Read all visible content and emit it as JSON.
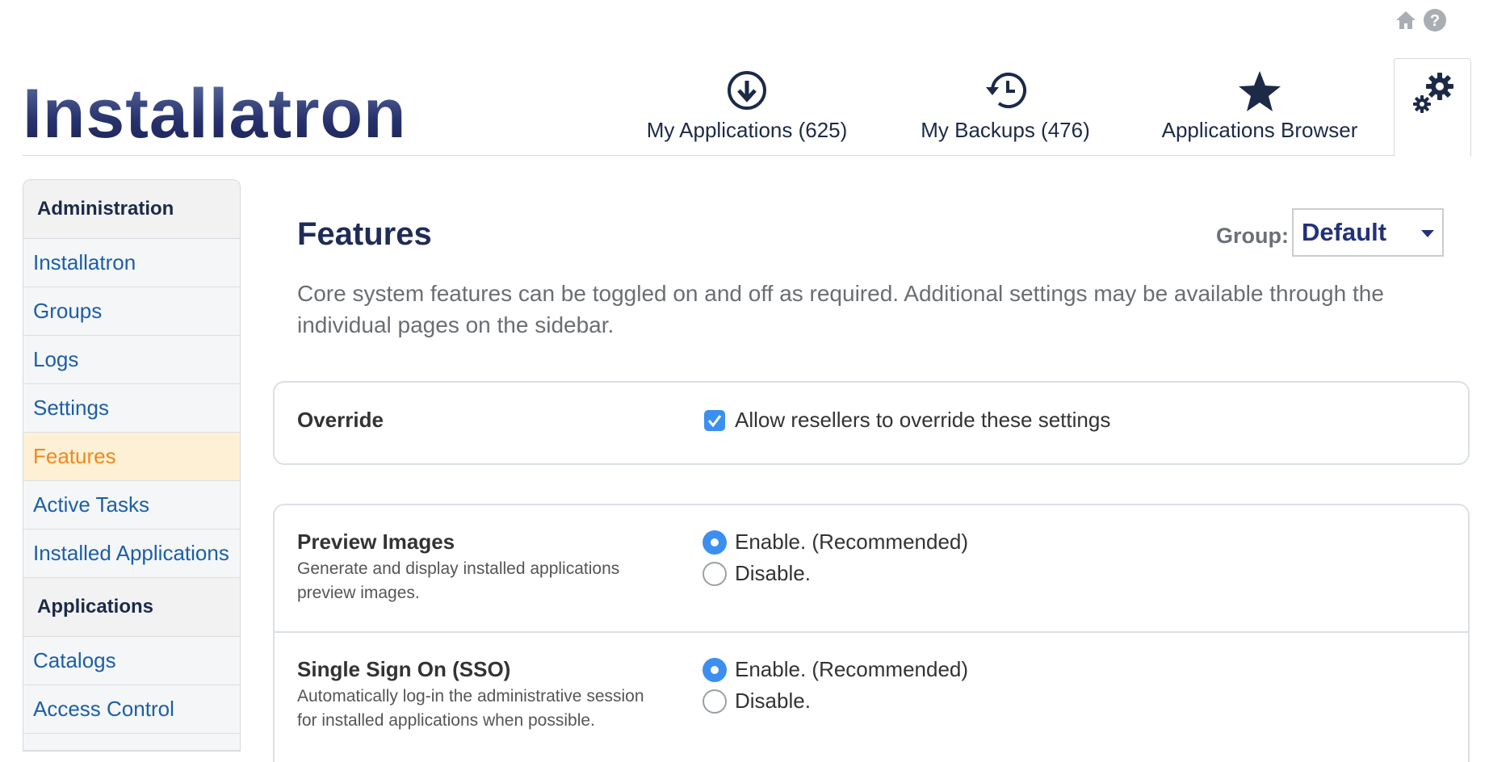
{
  "app": {
    "logo_text": "Installatron"
  },
  "nav": {
    "tabs": [
      {
        "label": "My Applications (625)",
        "icon": "download-circle-icon"
      },
      {
        "label": "My Backups (476)",
        "icon": "history-clock-icon"
      },
      {
        "label": "Applications Browser",
        "icon": "star-icon"
      }
    ],
    "settings_icon": "gears-icon",
    "top_icons": [
      "home-icon",
      "help-icon"
    ]
  },
  "sidebar": {
    "sections": [
      {
        "heading": "Administration",
        "items": [
          {
            "label": "Installatron",
            "active": false
          },
          {
            "label": "Groups",
            "active": false
          },
          {
            "label": "Logs",
            "active": false
          },
          {
            "label": "Settings",
            "active": false
          },
          {
            "label": "Features",
            "active": true
          },
          {
            "label": "Active Tasks",
            "active": false
          },
          {
            "label": "Installed Applications",
            "active": false
          }
        ]
      },
      {
        "heading": "Applications",
        "items": [
          {
            "label": "Catalogs",
            "active": false
          },
          {
            "label": "Access Control",
            "active": false
          }
        ]
      }
    ]
  },
  "main": {
    "title": "Features",
    "group_label": "Group:",
    "group_value": "Default",
    "description": "Core system features can be toggled on and off as required. Additional settings may be available through the individual pages on the sidebar.",
    "override": {
      "title": "Override",
      "checkbox_label": "Allow resellers to override these settings",
      "checked": true
    },
    "features": [
      {
        "title": "Preview Images",
        "description": "Generate and display installed applications preview images.",
        "enable_label": "Enable. (Recommended)",
        "disable_label": "Disable.",
        "selected": "enable"
      },
      {
        "title": "Single Sign On (SSO)",
        "description": "Automatically log-in the administrative session for installed applications when possible.",
        "enable_label": "Enable. (Recommended)",
        "disable_label": "Disable.",
        "selected": "enable"
      }
    ]
  },
  "colors": {
    "accent": "#3b8ff0",
    "link": "#1b5fa6",
    "active_item_bg": "#fdf0d5",
    "active_item_text": "#ec8a1b",
    "title": "#1f2c57"
  }
}
